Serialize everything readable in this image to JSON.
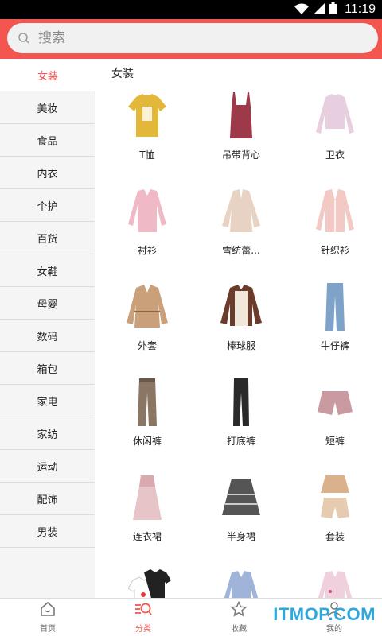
{
  "status_bar": {
    "time": "11:19"
  },
  "search": {
    "placeholder": "搜索"
  },
  "sidebar": {
    "items": [
      {
        "label": "女装",
        "active": true
      },
      {
        "label": "美妆"
      },
      {
        "label": "食品"
      },
      {
        "label": "内衣"
      },
      {
        "label": "个护"
      },
      {
        "label": "百货"
      },
      {
        "label": "女鞋"
      },
      {
        "label": "母婴"
      },
      {
        "label": "数码"
      },
      {
        "label": "箱包"
      },
      {
        "label": "家电"
      },
      {
        "label": "家纺"
      },
      {
        "label": "运动"
      },
      {
        "label": "配饰"
      },
      {
        "label": "男装"
      }
    ]
  },
  "content": {
    "section_title": "女装",
    "products": [
      {
        "label": "T恤",
        "icon": "tshirt-icon",
        "color": "#e3b83a"
      },
      {
        "label": "吊带背心",
        "icon": "camisole-icon",
        "color": "#9c3a4a"
      },
      {
        "label": "卫衣",
        "icon": "sweatshirt-icon",
        "color": "#e8cfe0"
      },
      {
        "label": "衬衫",
        "icon": "shirt-icon",
        "color": "#f0b9c6"
      },
      {
        "label": "雪纺蕾...",
        "icon": "chiffon-blouse-icon",
        "color": "#e8d2c4"
      },
      {
        "label": "针织衫",
        "icon": "cardigan-icon",
        "color": "#f2c9c4"
      },
      {
        "label": "外套",
        "icon": "trench-coat-icon",
        "color": "#c9a07a"
      },
      {
        "label": "棒球服",
        "icon": "baseball-jacket-icon",
        "color": "#6b3b2c"
      },
      {
        "label": "牛仔裤",
        "icon": "jeans-icon",
        "color": "#7ea2c8"
      },
      {
        "label": "休闲裤",
        "icon": "casual-pants-icon",
        "color": "#8b7563"
      },
      {
        "label": "打底裤",
        "icon": "leggings-icon",
        "color": "#2a2a2a"
      },
      {
        "label": "短裤",
        "icon": "shorts-icon",
        "color": "#c99aa0"
      },
      {
        "label": "连衣裙",
        "icon": "dress-icon",
        "color": "#e6c4c8"
      },
      {
        "label": "半身裙",
        "icon": "skirt-icon",
        "color": "#555555"
      },
      {
        "label": "套装",
        "icon": "outfit-set-icon",
        "color": "#d9b28c"
      },
      {
        "label": "",
        "icon": "tee-pair-icon",
        "color": "#222222"
      },
      {
        "label": "",
        "icon": "blue-blouse-icon",
        "color": "#9fb4d8"
      },
      {
        "label": "",
        "icon": "floral-top-icon",
        "color": "#efd0dc"
      }
    ]
  },
  "bottom_nav": [
    {
      "label": "首页",
      "icon": "home-icon"
    },
    {
      "label": "分类",
      "icon": "category-search-icon",
      "active": true
    },
    {
      "label": "收藏",
      "icon": "star-icon"
    },
    {
      "label": "我的",
      "icon": "user-icon"
    }
  ],
  "watermark": "ITMOP.COM",
  "accent_color": "#f2564f"
}
